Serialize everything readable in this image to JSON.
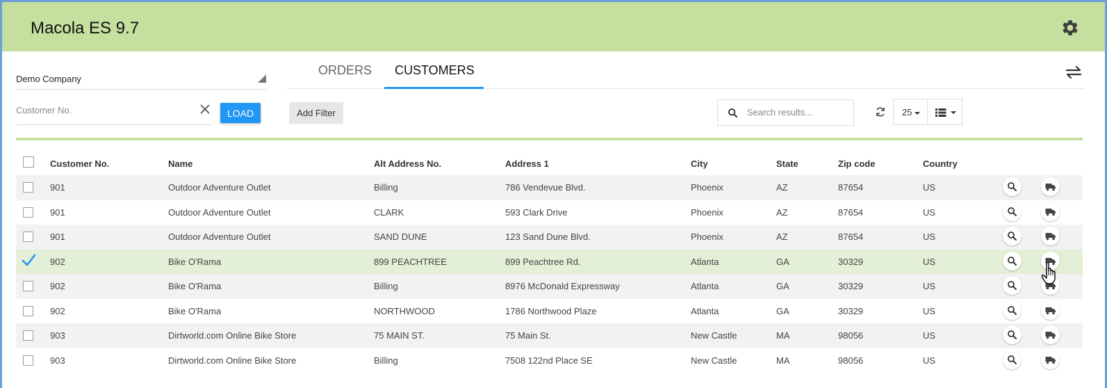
{
  "app": {
    "title": "Macola ES 9.7"
  },
  "company": {
    "selected": "Demo Company"
  },
  "customer_input": {
    "placeholder": "Customer No.",
    "value": ""
  },
  "load_label": "LOAD",
  "tabs": [
    {
      "label": "ORDERS",
      "active": false
    },
    {
      "label": "CUSTOMERS",
      "active": true
    }
  ],
  "toolbar": {
    "add_filter_label": "Add Filter",
    "search_placeholder": "Search results...",
    "page_size": "25"
  },
  "colors": {
    "header": "#c5df9f",
    "accent": "#2196f3",
    "selected_row": "#e3efd7"
  },
  "icons": [
    "gear-icon",
    "close-icon",
    "swap-icon",
    "search-icon",
    "refresh-icon",
    "list-view-icon",
    "magnify-icon",
    "truck-icon",
    "checkmark-icon",
    "hand-cursor-icon"
  ],
  "table": {
    "columns": [
      "Customer No.",
      "Name",
      "Alt Address No.",
      "Address 1",
      "City",
      "State",
      "Zip code",
      "Country"
    ],
    "rows": [
      {
        "cust": "901",
        "name": "Outdoor Adventure Outlet",
        "alt": "Billing",
        "addr": "786 Vendevue Blvd.",
        "city": "Phoenix",
        "state": "AZ",
        "zip": "87654",
        "country": "US",
        "selected": false
      },
      {
        "cust": "901",
        "name": "Outdoor Adventure Outlet",
        "alt": "CLARK",
        "addr": "593 Clark Drive",
        "city": "Phoenix",
        "state": "AZ",
        "zip": "87654",
        "country": "US",
        "selected": false
      },
      {
        "cust": "901",
        "name": "Outdoor Adventure Outlet",
        "alt": "SAND DUNE",
        "addr": "123 Sand Dune Blvd.",
        "city": "Phoenix",
        "state": "AZ",
        "zip": "87654",
        "country": "US",
        "selected": false
      },
      {
        "cust": "902",
        "name": "Bike O'Rama",
        "alt": "899 PEACHTREE",
        "addr": "899 Peachtree Rd.",
        "city": "Atlanta",
        "state": "GA",
        "zip": "30329",
        "country": "US",
        "selected": true
      },
      {
        "cust": "902",
        "name": "Bike O'Rama",
        "alt": "Billing",
        "addr": "8976 McDonald Expressway",
        "city": "Atlanta",
        "state": "GA",
        "zip": "30329",
        "country": "US",
        "selected": false
      },
      {
        "cust": "902",
        "name": "Bike O'Rama",
        "alt": "NORTHWOOD",
        "addr": "1786 Northwood Plaze",
        "city": "Atlanta",
        "state": "GA",
        "zip": "30329",
        "country": "US",
        "selected": false
      },
      {
        "cust": "903",
        "name": "Dirtworld.com Online Bike Store",
        "alt": "75 MAIN ST.",
        "addr": "75 Main St.",
        "city": "New Castle",
        "state": "MA",
        "zip": "98056",
        "country": "US",
        "selected": false
      },
      {
        "cust": "903",
        "name": "Dirtworld.com Online Bike Store",
        "alt": "Billing",
        "addr": "7508 122nd Place SE",
        "city": "New Castle",
        "state": "MA",
        "zip": "98056",
        "country": "US",
        "selected": false
      }
    ]
  }
}
